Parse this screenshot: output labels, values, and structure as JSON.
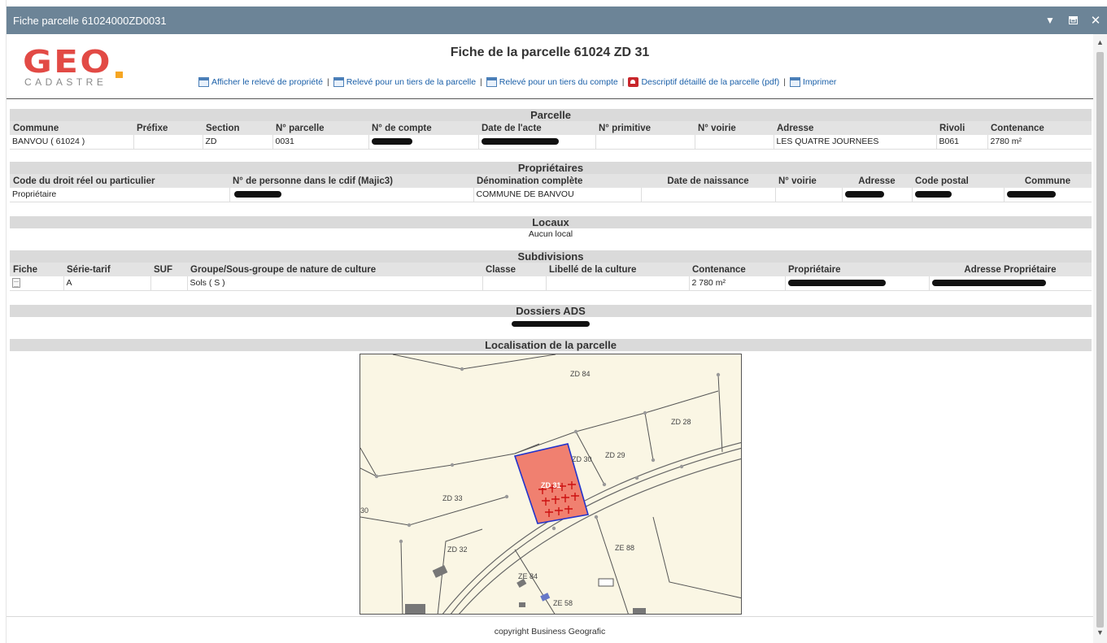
{
  "window": {
    "title": "Fiche parcelle 61024000ZD0031",
    "minimize_icon": "caret-down-icon",
    "restore_icon": "restore-icon",
    "close_icon": "close-icon"
  },
  "logo": {
    "main": "GEO",
    "sub": "CADASTRE",
    "colors": {
      "main": "#e24a45",
      "accent": "#f6a623"
    }
  },
  "page_title": "Fiche de la parcelle 61024 ZD 31",
  "actions": [
    {
      "label": "Afficher le relevé de propriété",
      "icon": "document-icon"
    },
    {
      "label": "Relevé pour un tiers de la parcelle",
      "icon": "document-icon"
    },
    {
      "label": "Relevé pour un tiers du compte",
      "icon": "document-icon"
    },
    {
      "label": "Descriptif détaillé de la parcelle (pdf)",
      "icon": "pdf-icon"
    },
    {
      "label": "Imprimer",
      "icon": "document-icon"
    }
  ],
  "parcelle": {
    "title": "Parcelle",
    "headers": [
      "Commune",
      "Préfixe",
      "Section",
      "N° parcelle",
      "N° de compte",
      "Date de l'acte",
      "N° primitive",
      "N° voirie",
      "Adresse",
      "Rivoli",
      "Contenance"
    ],
    "row": {
      "commune": "BANVOU ( 61024 )",
      "prefixe": "",
      "section": "ZD",
      "parcelle": "0031",
      "compte": "[redacted]",
      "date_acte": "[redacted]",
      "primitive": "",
      "voirie": "",
      "adresse": "LES QUATRE JOURNEES",
      "rivoli": "B061",
      "contenance": "2780 m²"
    }
  },
  "proprietaires": {
    "title": "Propriétaires",
    "headers": [
      "Code du droit réel ou particulier",
      "N° de personne dans le cdif (Majic3)",
      "Dénomination complète",
      "Date de naissance",
      "N° voirie",
      "Adresse",
      "Code postal",
      "Commune"
    ],
    "row": {
      "code": "Propriétaire",
      "personne": "[redacted]",
      "denomination": "COMMUNE DE BANVOU",
      "naissance": "",
      "voirie": "",
      "adresse": "[redacted]",
      "code_postal": "[redacted]",
      "commune": "[redacted]"
    }
  },
  "locaux": {
    "title": "Locaux",
    "text": "Aucun local"
  },
  "subdivisions": {
    "title": "Subdivisions",
    "headers": [
      "Fiche",
      "Série-tarif",
      "SUF",
      "Groupe/Sous-groupe de nature de culture",
      "Classe",
      "Libellé de la culture",
      "Contenance",
      "Propriétaire",
      "Adresse Propriétaire"
    ],
    "row": {
      "fiche_icon": "file-icon",
      "serie": "A",
      "suf": "",
      "groupe": "Sols ( S )",
      "classe": "",
      "libelle": "",
      "contenance": "2 780 m²",
      "proprietaire": "[redacted]",
      "adresse": "[redacted]"
    }
  },
  "dossiers": {
    "title": "Dossiers ADS",
    "text": "[redacted]"
  },
  "localisation": {
    "title": "Localisation de la parcelle",
    "labels": [
      "ZD 84",
      "ZD 28",
      "ZD 29",
      "ZD 30",
      "ZD 31",
      "ZD 33",
      "ZD 32",
      "ZE 88",
      "ZE 84",
      "ZE 58",
      "30"
    ],
    "colors": {
      "background": "#faf6e4",
      "selected_fill": "#f08070",
      "selected_border": "#2233cc",
      "cross": "#cc1111"
    }
  },
  "footer": {
    "copyright": "copyright Business Geografic"
  },
  "scrollbar": {
    "up_icon": "chevron-up-icon",
    "down_icon": "chevron-down-icon"
  }
}
